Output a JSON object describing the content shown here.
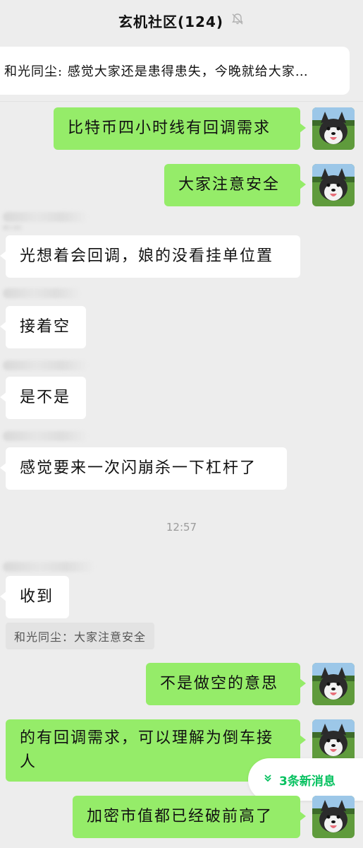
{
  "header": {
    "title": "玄机社区(124)",
    "mute_icon": "bell-slash-icon"
  },
  "pinned": {
    "text": "和光同尘: 感觉大家还是患得患失，今晚就给大家…"
  },
  "messages": [
    {
      "from": "self",
      "text": "比特币四小时线有回调需求"
    },
    {
      "from": "self",
      "text": "大家注意安全"
    },
    {
      "from": "other",
      "text": "光想着会回调，娘的没看挂单位置"
    },
    {
      "from": "other",
      "text": "接着空"
    },
    {
      "from": "other",
      "text": "是不是"
    },
    {
      "from": "other",
      "text": "感觉要来一次闪崩杀一下杠杆了"
    },
    {
      "from": "other",
      "text": "收到"
    },
    {
      "from": "self",
      "text": "不是做空的意思"
    },
    {
      "from": "self",
      "text": "的有回调需求，可以理解为倒车接人"
    },
    {
      "from": "self",
      "text": "加密市值都已经破前高了"
    }
  ],
  "timestamp": "12:57",
  "quote": "和光同尘：大家注意安全",
  "new_messages": {
    "label": "3条新消息",
    "icon": "double-chevron-down-icon"
  },
  "colors": {
    "background": "#ededed",
    "outgoing_bubble": "#95ec69",
    "incoming_bubble": "#ffffff",
    "accent": "#07c160"
  }
}
